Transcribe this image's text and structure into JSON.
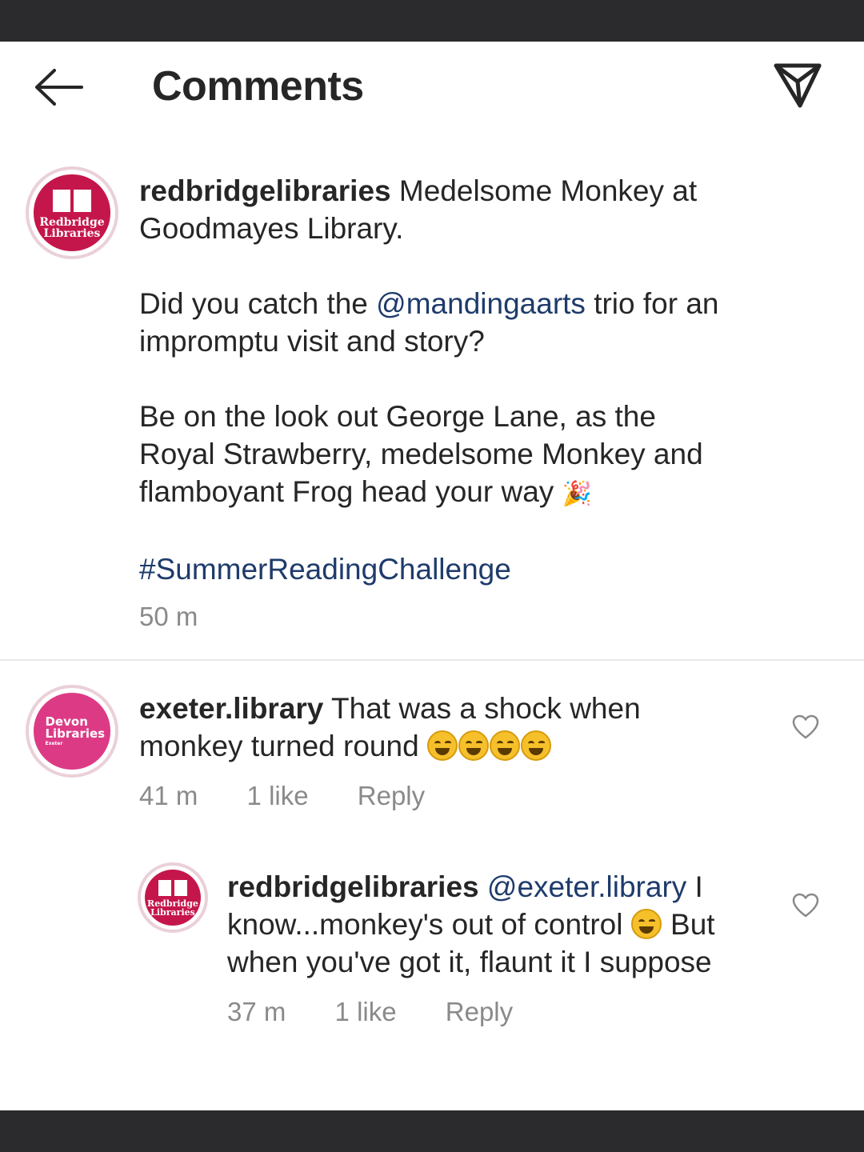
{
  "header": {
    "title": "Comments",
    "back_icon": "arrow-left-icon",
    "send_icon": "paper-plane-icon"
  },
  "caption": {
    "avatar_line1": "Redbridge",
    "avatar_line2": "Libraries",
    "username": "redbridgelibraries",
    "line1": "Medelsome Monkey at",
    "line2": "Goodmayes Library.",
    "p2_pre": "Did you catch the ",
    "p2_mention": "@mandingaarts",
    "p2_post": " trio for an",
    "p2_line2": "impromptu visit and story?",
    "p3_line1": "Be on the look out George Lane, as the",
    "p3_line2": "Royal Strawberry, medelsome Monkey and",
    "p3_line3": "flamboyant Frog head your way",
    "party_emoji": "🎉",
    "hashtag": "#SummerReadingChallenge",
    "time": "50 m"
  },
  "comments": [
    {
      "avatar_line1": "Devon",
      "avatar_line2": "Libraries",
      "avatar_line3": "Exeter",
      "username": "exeter.library",
      "line1": "That was a shock when",
      "line2": "monkey turned round",
      "emoji_count": 4,
      "time": "41 m",
      "likes": "1 like",
      "reply": "Reply"
    },
    {
      "avatar_line1": "Redbridge",
      "avatar_line2": "Libraries",
      "username": "redbridgelibraries",
      "mention": "@exeter.library",
      "line1_post": " I",
      "line2_pre": "know...monkey's out of control",
      "line2_post": "But",
      "line3": "when you've got it, flaunt it I suppose",
      "time": "37 m",
      "likes": "1 like",
      "reply": "Reply"
    }
  ],
  "colors": {
    "status_bar": "#2b2b2d",
    "link": "#1e3b6b",
    "meta": "#8a8a8a",
    "redbridge_brand": "#c5164b",
    "devon_brand": "#dd3a86"
  }
}
